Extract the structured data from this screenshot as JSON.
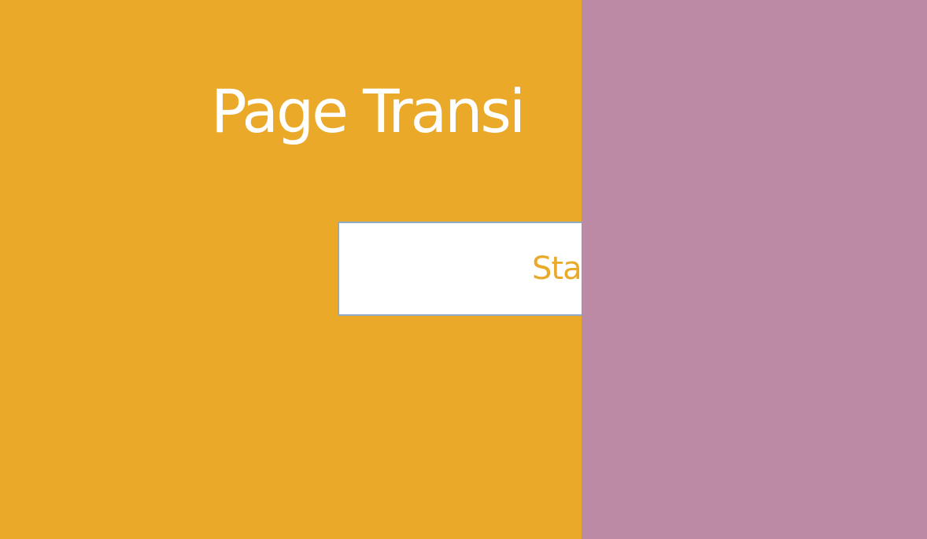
{
  "page": {
    "title": "Page Transi",
    "button_label": "Sta"
  },
  "colors": {
    "page_background": "#EAA929",
    "incoming_page_background": "#BC8AA5",
    "title_text": "#FFFFFF",
    "button_background": "#FFFFFF",
    "button_text": "#EAA929",
    "button_border": "#8FA9C9"
  }
}
